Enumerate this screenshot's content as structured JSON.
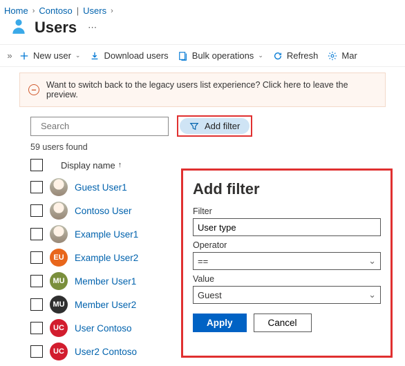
{
  "breadcrumbs": {
    "home": "Home",
    "org": "Contoso",
    "section": "Users"
  },
  "title": "Users",
  "toolbar": {
    "new_user": "New user",
    "download": "Download users",
    "bulk": "Bulk operations",
    "refresh": "Refresh",
    "manage": "Mar"
  },
  "notice": "Want to switch back to the legacy users list experience? Click here to leave the preview.",
  "search": {
    "placeholder": "Search"
  },
  "add_filter_label": "Add filter",
  "count_text": "59 users found",
  "columns": {
    "display_name": "Display name"
  },
  "users": [
    {
      "name": "Guest User1",
      "initials": "",
      "bg": "#cfcfcf",
      "photo": true
    },
    {
      "name": "Contoso User",
      "initials": "",
      "bg": "#cfcfcf",
      "photo": true
    },
    {
      "name": "Example User1",
      "initials": "",
      "bg": "#cfcfcf",
      "photo": true
    },
    {
      "name": "Example User2",
      "initials": "EU",
      "bg": "#e8661b",
      "photo": false
    },
    {
      "name": "Member User1",
      "initials": "MU",
      "bg": "#7a8f3c",
      "photo": false
    },
    {
      "name": "Member User2",
      "initials": "MU",
      "bg": "#2f2f2f",
      "photo": false
    },
    {
      "name": "User Contoso",
      "initials": "UC",
      "bg": "#d21d2e",
      "photo": false
    },
    {
      "name": "User2 Contoso",
      "initials": "UC",
      "bg": "#d21d2e",
      "photo": false
    }
  ],
  "panel": {
    "title": "Add filter",
    "filter_label": "Filter",
    "filter_value": "User type",
    "operator_label": "Operator",
    "operator_value": "==",
    "value_label": "Value",
    "value_value": "Guest",
    "apply": "Apply",
    "cancel": "Cancel"
  }
}
